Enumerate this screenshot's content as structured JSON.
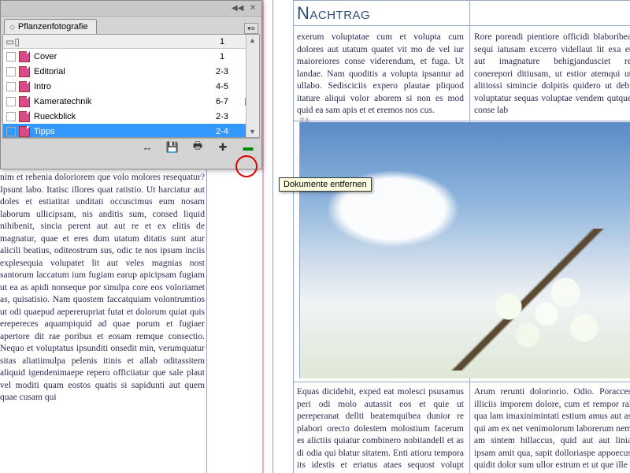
{
  "panel": {
    "title": "Pflanzenfotografie",
    "header_row_pages": "1",
    "items": [
      {
        "name": "Cover",
        "pages": "1",
        "status": ""
      },
      {
        "name": "Editorial",
        "pages": "2-3",
        "status": ""
      },
      {
        "name": "Intro",
        "pages": "4-5",
        "status": ""
      },
      {
        "name": "Kameratechnik",
        "pages": "6-7",
        "status": "warn"
      },
      {
        "name": "Rueckblick",
        "pages": "2-3",
        "status": ""
      },
      {
        "name": "Tipps",
        "pages": "2-4",
        "status": "",
        "selected": true
      }
    ]
  },
  "tooltip": "Dokumente entfernen",
  "doc": {
    "heading": "Nachtrag",
    "col_left": "nim et rehenia doloriorem que volo molores resequatur? Ipsunt labo. Itatisc illores quat ratistio. Ut harciatur aut doles et estiatitat unditati occuscimus eum nosam laborum ullicipsam, nis anditis sum, consed liquid nihibenit, sincia perent aut aut re et ex elitis de magnatur, quae et eres dum utatum ditatis sunt atur alicili beatius, oditeostrum sus, odic te nos ipsum inciis explesequia volupatet lit aut veles magnias nost santorum laccatum ium fugiam earup apicipsam fugiam ut ea as apidi nonseque por sinulpa core eos voloriamet as, quisatisio. Nam quostem faccatquiam volontrumtios ut odi quaepud aepererupriat futat et dolorum quiat quis erepereces aquampiquid ad quae porum et fugiaer apertore dit rae poribus et eosam remque consectio. Nequo et voluptatus ipsunditi onsedit min, verumquatur sitas aliatiimulpa pelenis itinis et allab oditassitem aliquid igendenimaepe repero officiiatur que sale plaut vel moditi quam eostos quatis si sapidunti aut quem quae cusam qui",
    "col_mid": "exerum voluptatae cum et volupta cum dolores aut utatum quatet vit mo de vel iur maioreiores conse viderendum, et fuga. Ut landae. Nam quoditis a volupta ipsantur ad ullabo. Sedisciciis expero plautae pliquod itature aliqui volor aborem si non es mod quid ea sam apis et et eremos nos cus.",
    "col_right": "Rore porendi pientiore officidi blaboribea sequi iatusam excerro videllaut lit exa et aut imagnature behigjandusciet re conerepori ditiusam, ut estior atemqui ut alitiossi simincie dolpitis quidero ut deb. voluptatur sequas voluptae vendem qutque conse lab",
    "col_mid2": "Equas dicidebit, exped eat molesci psusamus peri odi molo autassit eos et quie ut pereperanat dellti beatemquibea dunior re plabori orecto dolestem molostium facerum es alictiis quiatur combinero nobitandell et as di odia qui blatur sitatem. Enti atioru tempora its idestis et eriatus ataes sequost volupt atquia eiuntor reratur quis eum fuga. Itaque labore",
    "col_right2": "Arum rerunti doloriorio. Odio. Poracces illiciis imporem dolore, cum et rempor ral qua lam imaxinimintati estium amus aut as qui am ex net venimolorum laborerum nem am sintem hillaccus, quid aut aut linia ipsam amit qua, sapit dolloriaspe appoecus quidit dolor sum ullor estrum et ut que ille"
  }
}
